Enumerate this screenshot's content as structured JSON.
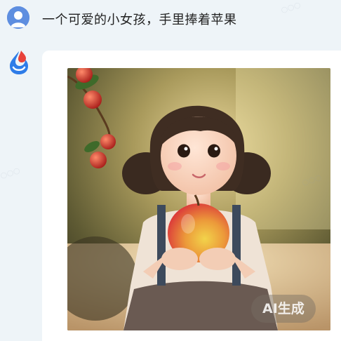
{
  "user_message": {
    "avatar_icon": "user-avatar-icon",
    "text": "一个可爱的小女孩，手里捧着苹果"
  },
  "assistant_message": {
    "avatar_icon": "assistant-logo-icon",
    "image": {
      "subject": "generated-portrait-image",
      "badge": "AI生成"
    }
  },
  "colors": {
    "page_background": "#eef4f8",
    "bubble_background": "#ffffff",
    "user_avatar": "#5e8ee0",
    "logo_blue": "#2e7ce8",
    "logo_red": "#e8413a"
  }
}
